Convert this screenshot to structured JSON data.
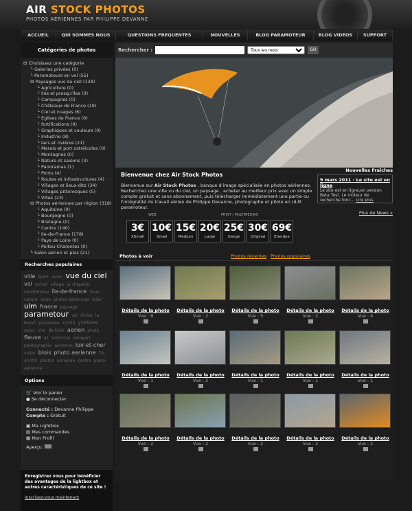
{
  "header": {
    "title_part1": "AIR ",
    "title_part2": "STOCK PHOTOS",
    "tagline": "PHOTOS AÉRIENNES PAR PHILIPPE DEVANNE"
  },
  "nav": [
    "ACCUEIL",
    "QUI SOMMES NOUS",
    "QUESTIONS FREQUENTES",
    "NOUVELLES",
    "BLOG PARAMOTEUR",
    "BLOG VIDEOS",
    "SUPPORT"
  ],
  "sidebar": {
    "categories_title": "Catégories de photos",
    "categories": [
      "Choisissez une catégorie",
      "Galeries privées (0)",
      "Paramoteurs en vol (55)",
      "Paysages vus du ciel (128)",
      "Agriculture (0)",
      "Iles et presqu'îles (0)",
      "Campagnes (0)",
      "Châteaux de France (19)",
      "Ciel et nuages (6)",
      "Eglises de France (0)",
      "fortifications (0)",
      "Graphiques et couleurs (0)",
      "Industrie (8)",
      "lacs et rivières (21)",
      "Marais et port ostréicoles (0)",
      "Montagnes (0)",
      "Nature et saisons (3)",
      "Panoramas (1)",
      "Ponts (4)",
      "Routes et infrastructures (4)",
      "Villages et lieux-dits (34)",
      "Villages pittoresques (5)",
      "Villes (23)",
      "Photos aériennes par région (318)",
      "Aquitaine (0)",
      "Bourgogne (0)",
      "Bretagne (0)",
      "Centre (140)",
      "Ile-de-France (178)",
      "Pays de Loire (0)",
      "Poitou-Charentes (0)",
      "Salon aérien et plus (21)"
    ],
    "popular_title": "Recherches populaires",
    "cloud": [
      "ville",
      "sport",
      "avion",
      "vue du ciel",
      "vol",
      "survol",
      "village",
      "la chapelle-vendômoise",
      "île-de-france",
      "hiver",
      "nature",
      "reine",
      "photos aériennes",
      "loisir",
      "ulm",
      "france",
      "paysage",
      "parametour",
      "val",
      "d'oise",
      "le breuil",
      "parasente",
      "41330",
      "yvelines",
      "salon",
      "ulm",
      "de blois",
      "aerien",
      "photo",
      "fleuve",
      "41",
      "motorisé",
      "aéroport",
      "photographie",
      "aerienne",
      "loir-et-cher",
      "voiler",
      "blois",
      "photo aerienne",
      "78",
      "41000",
      "photos",
      "aérienne",
      "centre",
      "photo aérienne"
    ],
    "options_title": "Options",
    "view_cart": "Voir le panier",
    "logout": "Se déconnecter",
    "connected_label": "Connecté :",
    "connected_value": "Devanne Philippe",
    "account_label": "Compte :",
    "account_value": "Gratuit",
    "lightbox": "Ma Lightbox",
    "orders": "Mes commandes",
    "profile": "Mon Profil",
    "preview_label": "Aperçu:",
    "promo": "Enregistrez vous pour bénéficier des avantages de la lightbox et autres caractéristiques de ce site !",
    "register": "Inscrivez-vous maintenant"
  },
  "search": {
    "label": "Rechercher :",
    "value": "",
    "mode": "Tous les mots",
    "go": "GO"
  },
  "welcome": {
    "title": "Bienvenue chez Air Stock Photos",
    "body_pre": "Bienvenue sur ",
    "brand": "Air Stock Photos ",
    "body_post": ", banque d'image spécialisée en photos aériennes. Recherchez une ville vu du ciel, un paysage , acheter au meilleur prix avec un simple compte gratuit et sans abonnement, puis télécharger immédiatement une partie ou l'intégralité du travail aérien de Philippe Devanne, photographe et pilote en ULM paramoteur."
  },
  "news": {
    "title": "Nouvelles Fraîches",
    "date": "9 mars 2011",
    "headline": " - Le site est en ligne",
    "text": "Le site est en ligne,en version Beta Test. Le moteur de recherche fonc...",
    "more": "Lire plus",
    "all": "Plus de News »"
  },
  "prices": {
    "web_label": "WEB",
    "print_label": "PRINT / MULTIMEDIAS",
    "currency": "€",
    "items": [
      {
        "v": "3",
        "l": "XSmall"
      },
      {
        "v": "10",
        "l": "Small"
      },
      {
        "v": "15",
        "l": "Medium"
      },
      {
        "v": "20",
        "l": "Large"
      },
      {
        "v": "25",
        "l": "Xlarge"
      },
      {
        "v": "30",
        "l": "Original"
      },
      {
        "v": "69",
        "l": "Etendue"
      }
    ]
  },
  "gallery": {
    "tab_active": "Photos à voir",
    "tab_recent": "Photos récentes",
    "tab_popular": "Photos populaires",
    "details": "Détails de la photo",
    "views": [
      "Vue : 6",
      "Vue : 2",
      "Vue : 5",
      "Vue : 2",
      "Vue : 4",
      "Vue : 1",
      "Vue : 2",
      "Vue : 1",
      "Vue : 1",
      "Vue : 1",
      "Vue : 2",
      "Vue : 2",
      "Vue : 2",
      "Vue : 2",
      "Vue : 2"
    ]
  }
}
